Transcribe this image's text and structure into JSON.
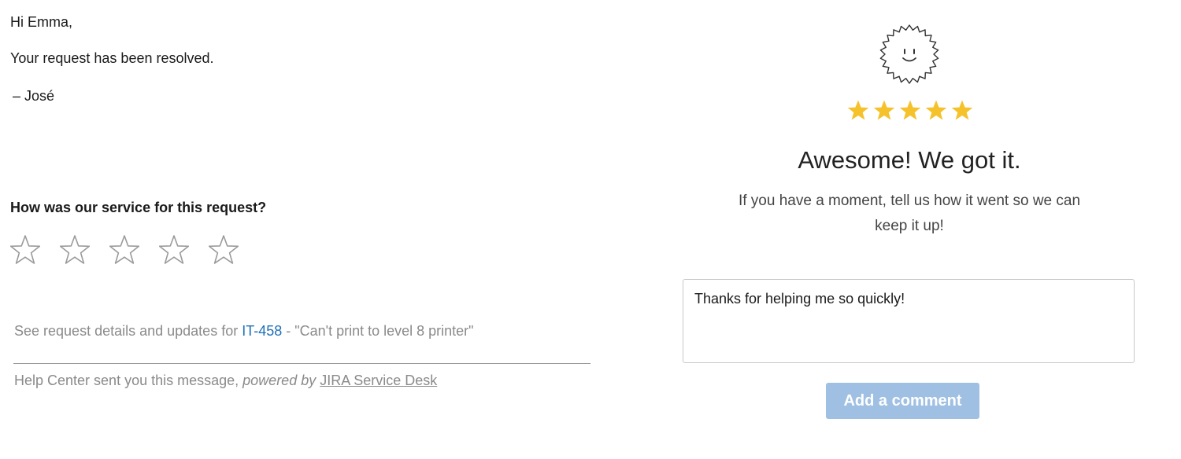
{
  "email": {
    "greeting": "Hi Emma,",
    "message": "Your request has been resolved.",
    "signature": "– José",
    "survey_question": "How was our service for this request?",
    "survey_stars": [
      {
        "icon": "star-outline-icon",
        "value": 1
      },
      {
        "icon": "star-outline-icon",
        "value": 2
      },
      {
        "icon": "star-outline-icon",
        "value": 3
      },
      {
        "icon": "star-outline-icon",
        "value": 4
      },
      {
        "icon": "star-outline-icon",
        "value": 5
      }
    ],
    "details": {
      "prefix": "See request details and updates for ",
      "issue_key": "IT-458",
      "suffix": " - \"Can't print to level 8 printer\""
    },
    "footer": {
      "prefix": "Help Center sent you this message, ",
      "powered_by": "powered by",
      "link": "JIRA Service Desk"
    }
  },
  "feedback": {
    "badge_icon": "smiley-badge-icon",
    "rating": 5,
    "rating_max": 5,
    "heading": "Awesome! We got it.",
    "subtext": "If you have a moment, tell us how it went so we can keep it up!",
    "comment_value": "Thanks for helping me so quickly!",
    "button_label": "Add a comment"
  },
  "colors": {
    "star_filled": "#f5c22c",
    "star_outline": "#9a9a9a",
    "link": "#1d6fb8",
    "button_bg": "#9fc0e3",
    "muted_text": "#8a8a8a"
  }
}
